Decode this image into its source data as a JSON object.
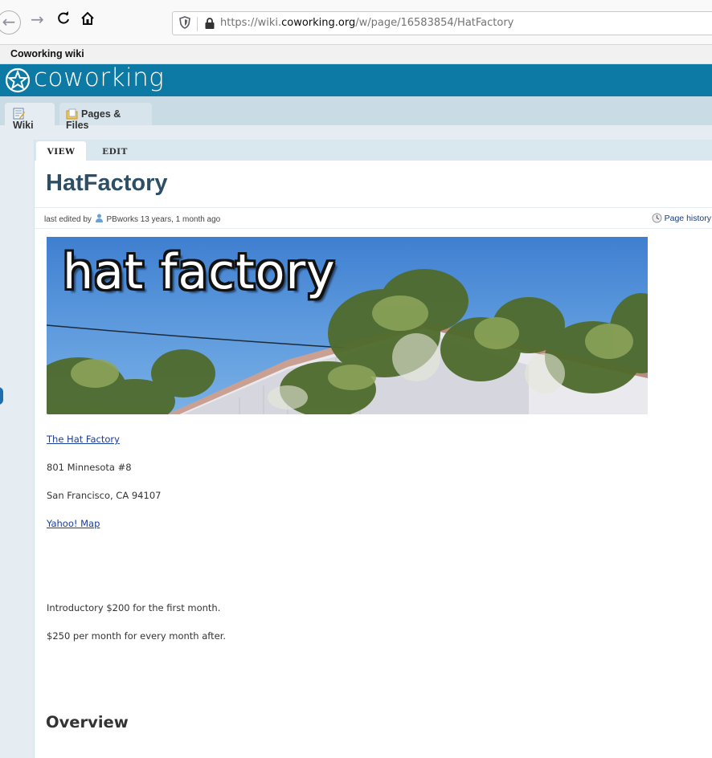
{
  "browser": {
    "url_prefix": "https://wiki.",
    "url_domain": "coworking.org",
    "url_path": "/w/page/16583854/HatFactory",
    "page_title": "Coworking wiki"
  },
  "header": {
    "logo_text": "coworking"
  },
  "mainnav": {
    "tabs": [
      {
        "label": "Wiki",
        "icon": "wiki-page-icon"
      },
      {
        "label": "Pages & Files",
        "icon": "folder-icon"
      }
    ]
  },
  "content": {
    "tabs": [
      {
        "label": "VIEW"
      },
      {
        "label": "EDIT"
      }
    ],
    "title": "HatFactory",
    "meta": {
      "prefix": "last edited by",
      "user": "PBworks",
      "age": "13 years, 1 month ago",
      "history_label": "Page history"
    },
    "banner_text": "hat factory",
    "lines": {
      "name_link": "The Hat Factory",
      "address1": "801 Minnesota #8",
      "address2": "San Francisco, CA 94107",
      "map_link": "Yahoo! Map",
      "price1": "Introductory $200 for the first month.",
      "price2": "$250 per month for every month after."
    },
    "section_heading": "Overview"
  },
  "colors": {
    "header": "#0c7aa4",
    "nav": "#c9dbe5",
    "title": "#2d4f66",
    "link": "#1a3c9a"
  }
}
